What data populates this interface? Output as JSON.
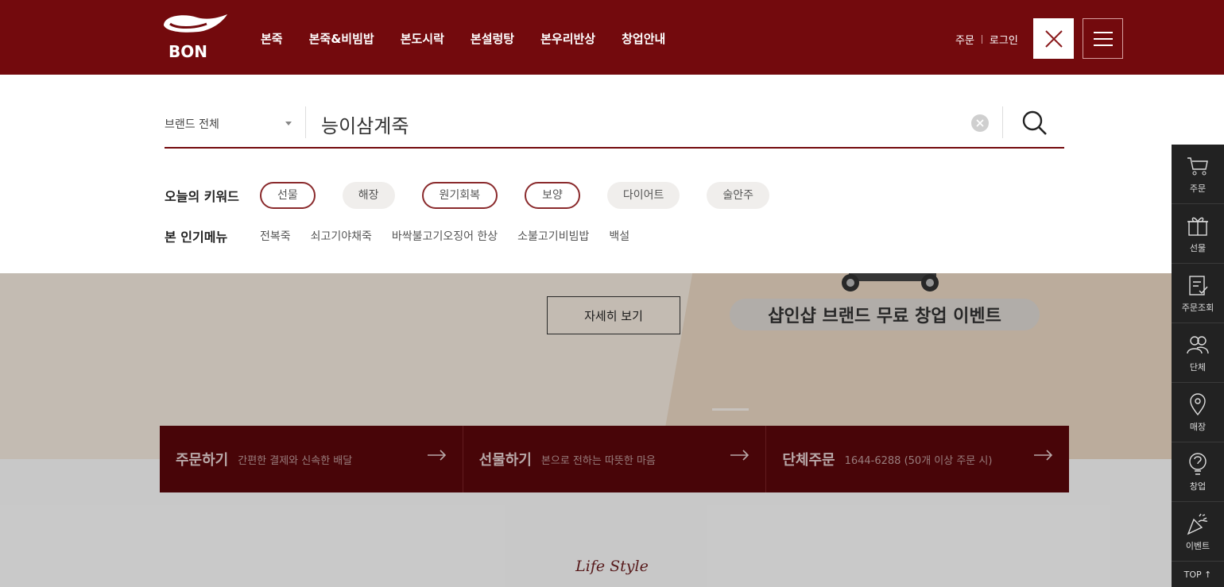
{
  "header": {
    "logo_text": "BON",
    "nav": [
      "본죽",
      "본죽&비빔밥",
      "본도시락",
      "본설렁탕",
      "본우리반상",
      "창업안내"
    ],
    "util_order": "주문",
    "util_login": "로그인"
  },
  "search": {
    "brand_select": "브랜드 전체",
    "query": "능이삼계죽"
  },
  "keywords": {
    "title": "오늘의 키워드",
    "items": [
      {
        "label": "선물",
        "active": true
      },
      {
        "label": "해장",
        "active": false
      },
      {
        "label": "원기회복",
        "active": true
      },
      {
        "label": "보양",
        "active": true
      },
      {
        "label": "다이어트",
        "active": false
      },
      {
        "label": "술안주",
        "active": false
      }
    ]
  },
  "popular": {
    "title": "본 인기메뉴",
    "items": [
      "전복죽",
      "쇠고기야채죽",
      "바싹불고기오징어 한상",
      "소불고기비빔밥",
      "백설"
    ]
  },
  "hero": {
    "detail_button": "자세히 보기",
    "event_text": "샵인샵 브랜드 무료 창업 이벤트"
  },
  "cta": [
    {
      "title": "주문하기",
      "desc": "간편한 결제와 신속한 배달"
    },
    {
      "title": "선물하기",
      "desc": "본으로 전하는 따뜻한 마음"
    },
    {
      "title": "단체주문",
      "desc": "1644-6288 (50개 이상 주문 시)"
    }
  ],
  "lifestyle": "Life Style",
  "quickmenu": {
    "items": [
      {
        "label": "주문",
        "icon": "cart-icon"
      },
      {
        "label": "선물",
        "icon": "gift-icon"
      },
      {
        "label": "주문조회",
        "icon": "order-check-icon"
      },
      {
        "label": "단체",
        "icon": "group-icon"
      },
      {
        "label": "매장",
        "icon": "location-pin-icon"
      },
      {
        "label": "창업",
        "icon": "question-bulb-icon"
      },
      {
        "label": "이벤트",
        "icon": "party-popper-icon"
      }
    ],
    "top": "TOP ↑"
  },
  "colors": {
    "brand": "#730a0d",
    "cta_bg": "#5a070a",
    "quick_bg": "#222222"
  }
}
